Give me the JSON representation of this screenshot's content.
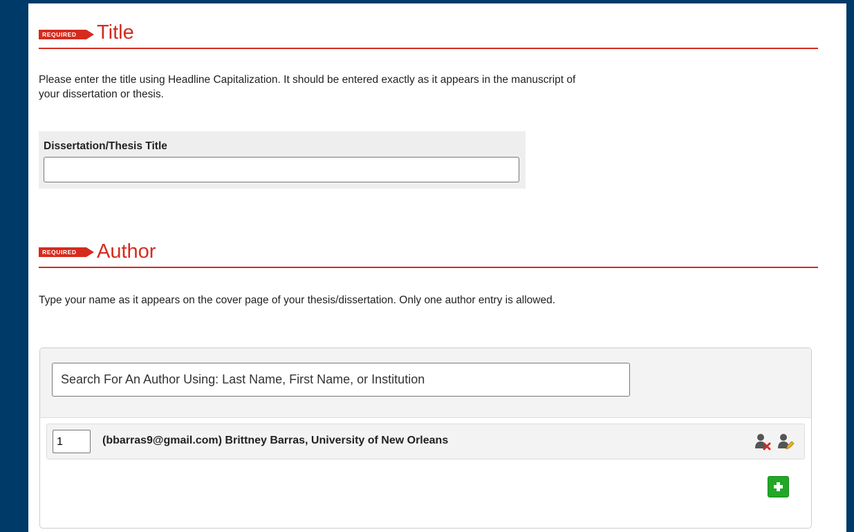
{
  "title_section": {
    "required_badge": "REQUIRED",
    "heading": "Title",
    "instructions": "Please enter the title using Headline Capitalization. It should be entered exactly as it appears in the manuscript of your dissertation or thesis.",
    "field_label": "Dissertation/Thesis Title",
    "field_value": ""
  },
  "author_section": {
    "required_badge": "REQUIRED",
    "heading": "Author",
    "instructions": "Type your name as it appears on the cover page of your thesis/dissertation. Only one author entry is allowed.",
    "search_placeholder": "Search For An Author Using: Last Name, First Name, or Institution",
    "authors": [
      {
        "order": "1",
        "text": "(bbarras9@gmail.com) Brittney Barras, University of New Orleans"
      }
    ],
    "icons": {
      "remove": "remove-author-icon",
      "edit": "edit-author-icon",
      "add": "add-author-icon"
    }
  },
  "colors": {
    "frame": "#003a68",
    "accent_red": "#d52b1e",
    "add_green": "#22a828"
  }
}
